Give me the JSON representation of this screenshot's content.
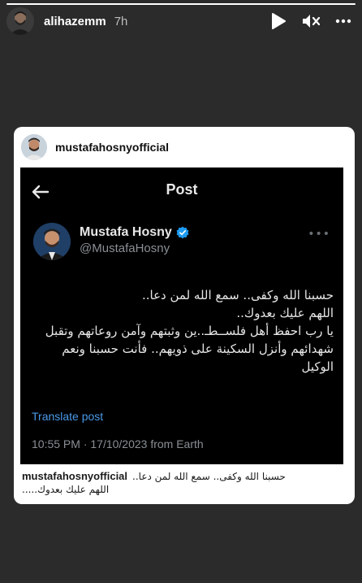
{
  "story": {
    "username": "alihazemm",
    "time_ago": "7h",
    "progress": 1.0,
    "controls": [
      "play-icon",
      "mute-icon",
      "more-icon"
    ]
  },
  "shared_card": {
    "username": "mustafahosnyofficial",
    "post": {
      "header_title": "Post",
      "author_name": "Mustafa Hosny",
      "author_handle": "@MustafaHosny",
      "verified": true,
      "text_lines": [
        "حسبنا الله وكفى.. سمع الله لمن دعا..",
        "اللهم عليك بعدوك..",
        "يا رب احفظ أهل فلســطـ..ين وثبتهم وآمن روعاتهم وتقبل شهدائهم وأنزل السكينة على ذويهم.. فأنت حسبنا ونعم الوكيل"
      ],
      "translate_label": "Translate post",
      "meta": "10:55 PM · 17/10/2023 from Earth"
    },
    "caption": {
      "username": "mustafahosnyofficial",
      "line1": "حسبنا الله وكفى.. سمع الله لمن دعا..",
      "line2": "اللهم عليك بعدوك....."
    }
  },
  "colors": {
    "background": "#2b2b2b",
    "link": "#4a99e9",
    "verified": "#1d9bf0"
  }
}
